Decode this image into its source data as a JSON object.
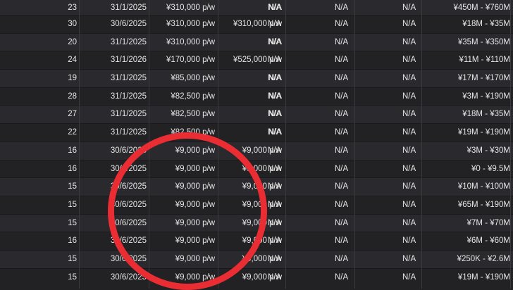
{
  "rows": [
    {
      "age": "23",
      "expires": "31/1/2025",
      "wage": "¥310,000 p/w",
      "release_clause": "N/A",
      "col5": "N/A",
      "col6": "N/A",
      "col7": "N/A",
      "value": "¥450M - ¥760M"
    },
    {
      "age": "30",
      "expires": "30/6/2025",
      "wage": "¥310,000 p/w",
      "release_clause": "¥310,000 p/w",
      "col5": "N/A",
      "col6": "N/A",
      "col7": "N/A",
      "value": "¥18M - ¥35M"
    },
    {
      "age": "20",
      "expires": "31/1/2025",
      "wage": "¥310,000 p/w",
      "release_clause": "N/A",
      "col5": "N/A",
      "col6": "N/A",
      "col7": "N/A",
      "value": "¥35M - ¥350M"
    },
    {
      "age": "24",
      "expires": "31/1/2026",
      "wage": "¥170,000 p/w",
      "release_clause": "¥525,000 p/w",
      "col5": "N/A",
      "col6": "N/A",
      "col7": "N/A",
      "value": "¥11M - ¥110M"
    },
    {
      "age": "19",
      "expires": "31/1/2025",
      "wage": "¥85,000 p/w",
      "release_clause": "N/A",
      "col5": "N/A",
      "col6": "N/A",
      "col7": "N/A",
      "value": "¥17M - ¥170M"
    },
    {
      "age": "28",
      "expires": "31/1/2025",
      "wage": "¥82,500 p/w",
      "release_clause": "N/A",
      "col5": "N/A",
      "col6": "N/A",
      "col7": "N/A",
      "value": "¥3M - ¥190M"
    },
    {
      "age": "27",
      "expires": "31/1/2025",
      "wage": "¥82,500 p/w",
      "release_clause": "N/A",
      "col5": "N/A",
      "col6": "N/A",
      "col7": "N/A",
      "value": "¥18M - ¥35M"
    },
    {
      "age": "22",
      "expires": "31/1/2025",
      "wage": "¥82,500 p/w",
      "release_clause": "N/A",
      "col5": "N/A",
      "col6": "N/A",
      "col7": "N/A",
      "value": "¥19M - ¥190M"
    },
    {
      "age": "16",
      "expires": "30/6/2025",
      "wage": "¥9,000 p/w",
      "release_clause": "¥9,000 p/w",
      "col5": "N/A",
      "col6": "N/A",
      "col7": "N/A",
      "value": "¥3M - ¥30M"
    },
    {
      "age": "16",
      "expires": "30/6/2025",
      "wage": "¥9,000 p/w",
      "release_clause": "¥9,000 p/w",
      "col5": "N/A",
      "col6": "N/A",
      "col7": "N/A",
      "value": "¥0 - ¥9.5M"
    },
    {
      "age": "15",
      "expires": "30/6/2025",
      "wage": "¥9,000 p/w",
      "release_clause": "¥9,000 p/w",
      "col5": "N/A",
      "col6": "N/A",
      "col7": "N/A",
      "value": "¥10M - ¥100M"
    },
    {
      "age": "15",
      "expires": "30/6/2025",
      "wage": "¥9,000 p/w",
      "release_clause": "¥9,000 p/w",
      "col5": "N/A",
      "col6": "N/A",
      "col7": "N/A",
      "value": "¥65M - ¥190M"
    },
    {
      "age": "15",
      "expires": "30/6/2025",
      "wage": "¥9,000 p/w",
      "release_clause": "¥9,000 p/w",
      "col5": "N/A",
      "col6": "N/A",
      "col7": "N/A",
      "value": "¥7M - ¥70M"
    },
    {
      "age": "16",
      "expires": "30/6/2025",
      "wage": "¥9,000 p/w",
      "release_clause": "¥9,000 p/w",
      "col5": "N/A",
      "col6": "N/A",
      "col7": "N/A",
      "value": "¥6M - ¥60M"
    },
    {
      "age": "15",
      "expires": "30/6/2025",
      "wage": "¥9,000 p/w",
      "release_clause": "¥9,000 p/w",
      "col5": "N/A",
      "col6": "N/A",
      "col7": "N/A",
      "value": "¥250K - ¥2.6M"
    },
    {
      "age": "15",
      "expires": "30/6/2025",
      "wage": "¥9,000 p/w",
      "release_clause": "¥9,000 p/w",
      "col5": "N/A",
      "col6": "N/A",
      "col7": "N/A",
      "value": "¥19M - ¥190M"
    }
  ],
  "annotation": {
    "shape": "circle",
    "color": "#ea2d33"
  }
}
